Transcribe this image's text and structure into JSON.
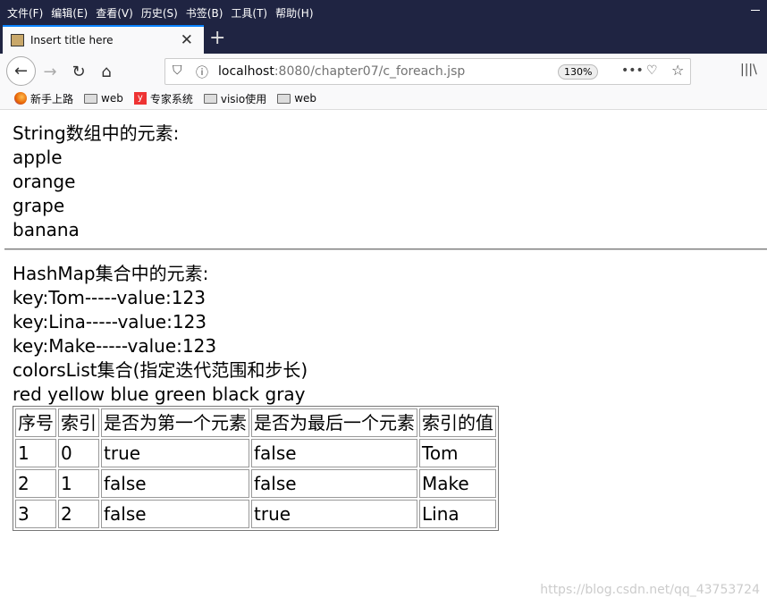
{
  "menu": [
    "文件(F)",
    "编辑(E)",
    "查看(V)",
    "历史(S)",
    "书签(B)",
    "工具(T)",
    "帮助(H)"
  ],
  "tab": {
    "title": "Insert title here"
  },
  "url": {
    "host": "localhost",
    "rest": ":8080/chapter07/c_foreach.jsp",
    "zoom": "130%"
  },
  "bookmarks": [
    "新手上路",
    "web",
    "专家系统",
    "visio使用",
    "web"
  ],
  "page": {
    "string_heading": "String数组中的元素:",
    "fruits": [
      "apple",
      "orange",
      "grape",
      "banana"
    ],
    "map_heading": "HashMap集合中的元素:",
    "map_entries": [
      "key:Tom-----value:123",
      "key:Lina-----value:123",
      "key:Make-----value:123"
    ],
    "colors_heading": "colorsList集合(指定迭代范围和步长)",
    "colors": "red yellow blue green black gray"
  },
  "table": {
    "headers": [
      "序号",
      "索引",
      "是否为第一个元素",
      "是否为最后一个元素",
      "索引的值"
    ],
    "rows": [
      [
        "1",
        "0",
        "true",
        "false",
        "Tom"
      ],
      [
        "2",
        "1",
        "false",
        "false",
        "Make"
      ],
      [
        "3",
        "2",
        "false",
        "true",
        "Lina"
      ]
    ]
  },
  "watermark": "https://blog.csdn.net/qq_43753724"
}
